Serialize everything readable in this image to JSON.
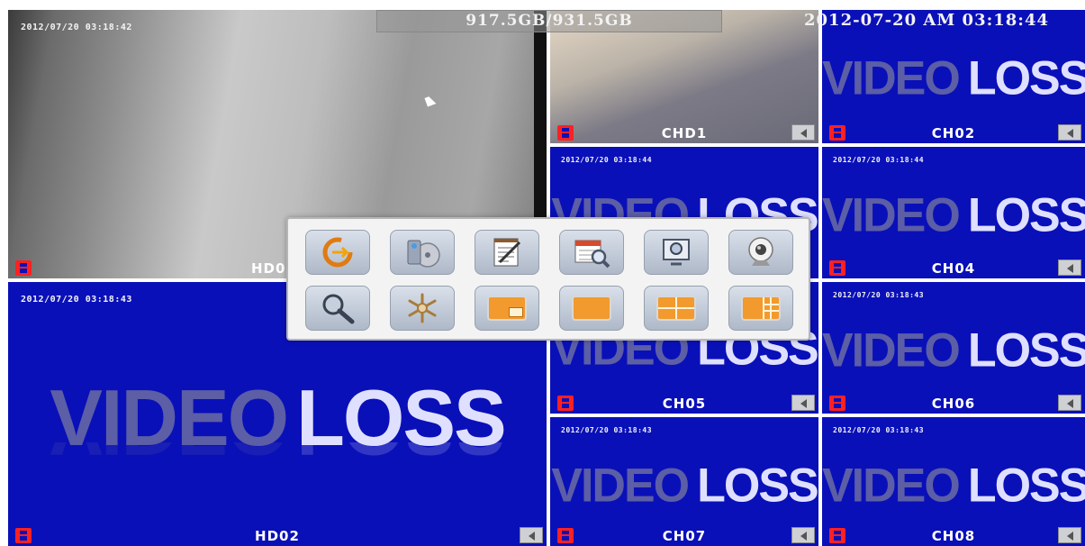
{
  "storage": "917.5GB/931.5GB",
  "datetime": "2012-07-20 AM 03:18:44",
  "video_loss": {
    "word1": "VIDEO",
    "word2": "LOSS"
  },
  "channels": [
    {
      "id": "hd01",
      "name": "HD0",
      "timestamp": "2012/07/20 03:18:42",
      "state": "live"
    },
    {
      "id": "chd1",
      "name": "CHD1",
      "timestamp": "",
      "state": "live"
    },
    {
      "id": "ch02",
      "name": "CH02",
      "timestamp": "",
      "state": "video-loss"
    },
    {
      "id": "ch03",
      "name": "",
      "timestamp": "2012/07/20 03:18:44",
      "state": "video-loss"
    },
    {
      "id": "ch04",
      "name": "CH04",
      "timestamp": "2012/07/20 03:18:44",
      "state": "video-loss"
    },
    {
      "id": "hd02",
      "name": "HD02",
      "timestamp": "2012/07/20 03:18:43",
      "state": "video-loss"
    },
    {
      "id": "ch05",
      "name": "CH05",
      "timestamp": "",
      "state": "video-loss"
    },
    {
      "id": "ch06",
      "name": "CH06",
      "timestamp": "2012/07/20 03:18:43",
      "state": "video-loss"
    },
    {
      "id": "ch07",
      "name": "CH07",
      "timestamp": "2012/07/20 03:18:43",
      "state": "video-loss"
    },
    {
      "id": "ch08",
      "name": "CH08",
      "timestamp": "2012/07/20 03:18:43",
      "state": "video-loss"
    }
  ],
  "menu": {
    "row1": [
      "logout-icon",
      "system-disc-icon",
      "notepad-icon",
      "calendar-search-icon",
      "monitor-search-icon",
      "webcam-icon"
    ],
    "row2": [
      "magnifier-icon",
      "snowflake-icon",
      "pip-layout-icon",
      "single-layout-icon",
      "quad-layout-icon",
      "multi-layout-icon"
    ]
  },
  "colors": {
    "tile_blue": "#0a10b8",
    "rec_red": "#ff2020",
    "screen_orange": "#f29a2e"
  }
}
